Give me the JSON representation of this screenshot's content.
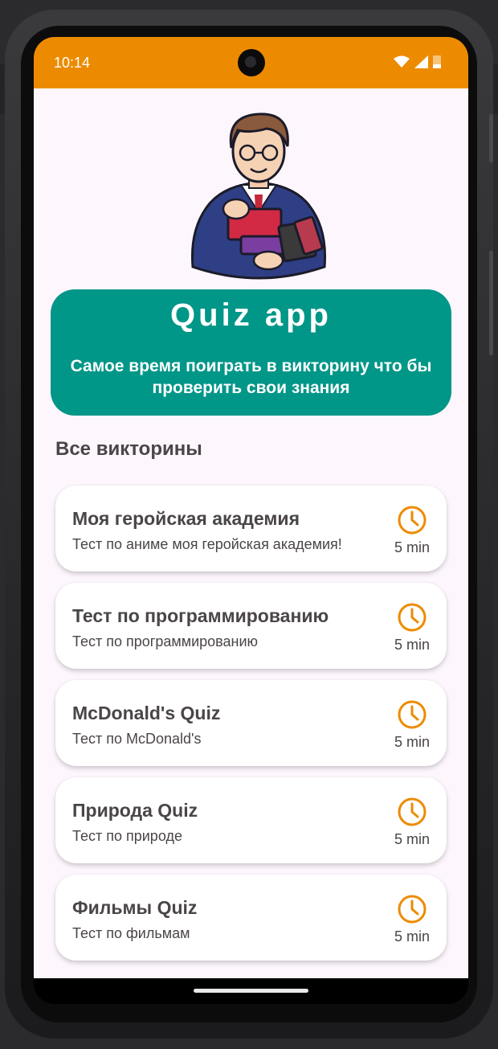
{
  "status_bar": {
    "time": "10:14",
    "accent_color": "#ed8b00"
  },
  "hero": {
    "title": "Quiz app",
    "subtitle": "Самое время поиграть в викторину что бы проверить свои знания",
    "color": "#009688"
  },
  "section": {
    "heading": "Все викторины"
  },
  "quizzes": [
    {
      "title": "Моя геройская академия",
      "description": "Тест по аниме моя геройская академия!",
      "duration": "5 min",
      "icon": "clock-icon"
    },
    {
      "title": "Тест по программированию",
      "description": "Тест по программированию",
      "duration": "5 min",
      "icon": "clock-icon"
    },
    {
      "title": "McDonald's Quiz",
      "description": "Тест по McDonald's",
      "duration": "5 min",
      "icon": "clock-icon"
    },
    {
      "title": "Природа Quiz",
      "description": "Тест по природе",
      "duration": "5 min",
      "icon": "clock-icon"
    },
    {
      "title": "Фильмы Quiz",
      "description": "Тест по фильмам",
      "duration": "5 min",
      "icon": "clock-icon"
    }
  ],
  "icons": {
    "illustration": "teacher-with-books-illustration",
    "clock_color": "#ed8b00"
  }
}
